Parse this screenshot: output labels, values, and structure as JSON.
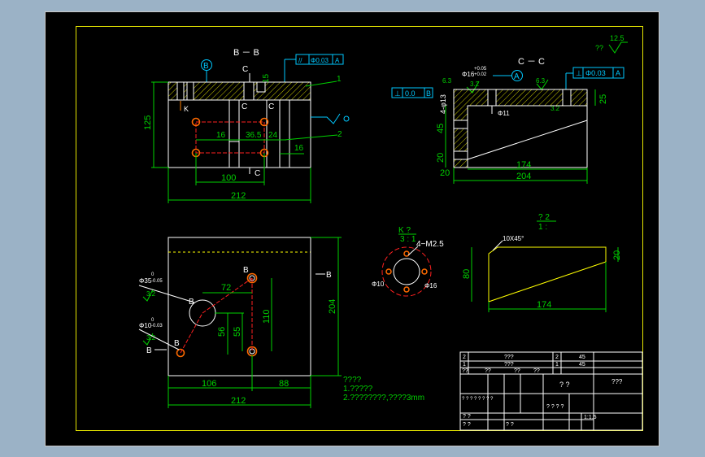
{
  "colors": {
    "window_bg": "#9bb2c6",
    "paper": "#000000",
    "frame": "#e6e600",
    "part_outline": "#ffffff",
    "dimension": "#00d200",
    "callout": "#00c8ff",
    "hidden_line": "#ffff00",
    "hatch": "#ffff00",
    "red_line": "#ff2020",
    "hole": "#ff6a00"
  },
  "views": {
    "bb": {
      "title": "B － B",
      "section_marker": "B",
      "tol_symbol": "//",
      "tol_value": "Φ0.03",
      "tol_datum": "A",
      "leader_1": "1",
      "leader_2": "2",
      "cut_c_top": "C",
      "cut_c_mid": "C",
      "cut_c_bottom": "C",
      "arrow_k": "K"
    },
    "cc": {
      "title": "C － C",
      "perp_left_symbol": "⊥",
      "perp_left_value": "0.0",
      "perp_left_datum": "B",
      "perp_right_symbol": "⊥",
      "perp_right_value": "Φ0.03",
      "perp_right_datum": "A",
      "datum_a": "A",
      "hole_spec": "Φ16",
      "hole_tol_upper": "+0.05",
      "hole_tol_lower": "+0.02",
      "small_hole": "Φ11",
      "holes_note": "4-φ13",
      "rough_a": "6.3",
      "rough_b": "3.2",
      "rough_c": "6.3",
      "rough_d": "3.2"
    },
    "plan": {
      "hole_a_spec": "Φ35",
      "hole_a_tol_upper": "0",
      "hole_a_tol_lower": "-0.05",
      "hole_a_rough": "3.2",
      "hole_b_spec": "Φ10",
      "hole_b_tol_upper": "0",
      "hole_b_tol_lower": "-0.03",
      "hole_b_rough": "3.2",
      "marker_b1": "B",
      "marker_b2": "B",
      "marker_b3": "B",
      "marker_b4": "B",
      "marker_b5": "B"
    },
    "detail_k": {
      "title": "K ?",
      "scale": "3 : 1",
      "thread_note": "4−M2.5",
      "inner_dia": "Φ10",
      "outer_dia": "Φ16"
    },
    "detail_rib": {
      "title": "? 2",
      "scale": "1 :",
      "chamfer": "10X45°"
    }
  },
  "dimensions": {
    "bb_height": "125",
    "bb_15": "15",
    "bb_16a": "16",
    "bb_36_5": "36.5",
    "bb_24": "24",
    "bb_16b": "16",
    "bb_100": "100",
    "bb_212": "212",
    "cc_25": "25",
    "cc_45": "45",
    "cc_20a": "20",
    "cc_20b": "20",
    "cc_174": "174",
    "cc_204": "204",
    "plan_72": "72",
    "plan_110": "110",
    "plan_56": "56",
    "plan_55": "55",
    "plan_106": "106",
    "plan_88": "88",
    "plan_212": "212",
    "plan_204": "204",
    "rib_80": "80",
    "rib_20": "20",
    "rib_174": "174"
  },
  "roughness_mark": {
    "value": "12.5",
    "label": "??"
  },
  "notes": {
    "title": "????",
    "line1": "1.?????",
    "line2": "2.????????,????3mm"
  },
  "title_block": {
    "r1_c1": "2",
    "r1_c2": "???",
    "r1_c3": "2",
    "r1_c4": "45",
    "r2_c1": "1",
    "r2_c2": "???",
    "r2_c3": "1",
    "r2_c4": "45",
    "r3_c1": "??",
    "r3_c2": "??",
    "r3_c3": "??",
    "r3_c4": "??",
    "drawing_name": "?   ?",
    "drawing_code": "???",
    "material_row": "?  ?  ? ?    ?  ?  ?  ?",
    "weight_row": "?  ?   ?  ?",
    "scale_label": "1:1.5",
    "left_row1": "?  ?",
    "left_row2": "?  ?",
    "left_row3": "?  ?"
  }
}
